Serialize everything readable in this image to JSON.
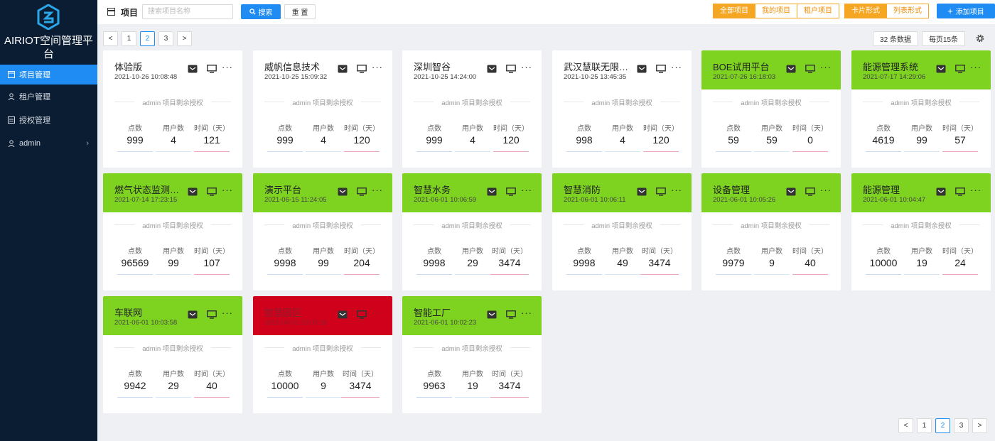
{
  "sidebar": {
    "brand": "AIRIOT空间管理平台",
    "items": [
      {
        "label": "项目管理",
        "icon": "project-icon",
        "active": true
      },
      {
        "label": "租户管理",
        "icon": "tenant-icon",
        "active": false
      },
      {
        "label": "授权管理",
        "icon": "license-icon",
        "active": false
      },
      {
        "label": "admin",
        "icon": "user-icon",
        "active": false
      }
    ]
  },
  "header": {
    "title": "项目",
    "search_placeholder": "搜索项目名称",
    "search_label": "搜索",
    "reset_label": "重 置",
    "filters": [
      "全部项目",
      "我的项目",
      "租户项目"
    ],
    "views": [
      "卡片形式",
      "列表形式"
    ],
    "add_label": "添加项目"
  },
  "pagination": {
    "prev": "<",
    "next": ">",
    "pages": [
      "1",
      "2",
      "3"
    ],
    "current": "2",
    "count_label": "32 条数据",
    "per_page_label": "每页15条"
  },
  "card_labels": {
    "license_note": "admin 项目剩余授权",
    "points": "点数",
    "users": "用户数",
    "days": "时间（天）",
    "more": "···"
  },
  "colors": {
    "accent": "#1e8cf3",
    "orange": "#f5a623",
    "green": "#7ed321",
    "red": "#d0021b",
    "sidebar": "#0b1d33"
  },
  "projects": [
    {
      "name": "体验版",
      "date": "2021-10-26 10:08:48",
      "points": "999",
      "users": "4",
      "days": "121",
      "status": "white"
    },
    {
      "name": "威帆信息技术",
      "date": "2021-10-25 15:09:32",
      "points": "999",
      "users": "4",
      "days": "120",
      "status": "white"
    },
    {
      "name": "深圳智谷",
      "date": "2021-10-25 14:24:00",
      "points": "999",
      "users": "4",
      "days": "120",
      "status": "white"
    },
    {
      "name": "武汉慧联无限科技",
      "date": "2021-10-25 13:45:35",
      "points": "998",
      "users": "4",
      "days": "120",
      "status": "white"
    },
    {
      "name": "BOE试用平台",
      "date": "2021-07-26 16:18:03",
      "points": "59",
      "users": "59",
      "days": "0",
      "status": "green"
    },
    {
      "name": "能源管理系统",
      "date": "2021-07-17 14:29:06",
      "points": "4619",
      "users": "99",
      "days": "57",
      "status": "green"
    },
    {
      "name": "燃气状态监测平台",
      "date": "2021-07-14 17:23:15",
      "points": "96569",
      "users": "99",
      "days": "107",
      "status": "green"
    },
    {
      "name": "演示平台",
      "date": "2021-06-15 11:24:05",
      "points": "9998",
      "users": "99",
      "days": "204",
      "status": "green"
    },
    {
      "name": "智慧水务",
      "date": "2021-06-01 10:06:59",
      "points": "9998",
      "users": "29",
      "days": "3474",
      "status": "green"
    },
    {
      "name": "智慧消防",
      "date": "2021-06-01 10:06:11",
      "points": "9998",
      "users": "49",
      "days": "3474",
      "status": "green"
    },
    {
      "name": "设备管理",
      "date": "2021-06-01 10:05:26",
      "points": "9979",
      "users": "9",
      "days": "40",
      "status": "green"
    },
    {
      "name": "能源管理",
      "date": "2021-06-01 10:04:47",
      "points": "10000",
      "users": "19",
      "days": "24",
      "status": "green"
    },
    {
      "name": "车联网",
      "date": "2021-06-01 10:03:58",
      "points": "9942",
      "users": "29",
      "days": "40",
      "status": "green"
    },
    {
      "name": "智慧园区",
      "date": "2021-06-01 10:03:16",
      "points": "10000",
      "users": "9",
      "days": "3474",
      "status": "red"
    },
    {
      "name": "智能工厂",
      "date": "2021-06-01 10:02:23",
      "points": "9963",
      "users": "19",
      "days": "3474",
      "status": "green"
    }
  ]
}
